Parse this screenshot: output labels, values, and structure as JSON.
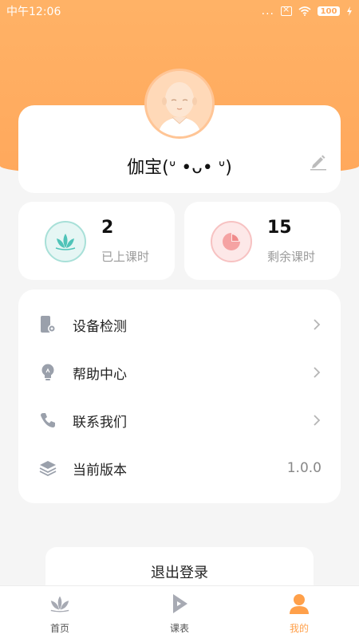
{
  "status_bar": {
    "time": "中午12:06",
    "signal": "...",
    "battery": "100"
  },
  "profile": {
    "nickname": "伽宝(ᐡ •ᴗ• ᐡ)"
  },
  "stats": [
    {
      "value": "2",
      "label": "已上课时",
      "icon": "lotus-icon"
    },
    {
      "value": "15",
      "label": "剩余课时",
      "icon": "pie-chart-icon"
    }
  ],
  "menu": {
    "items": [
      {
        "label": "设备检测",
        "icon": "device-check-icon"
      },
      {
        "label": "帮助中心",
        "icon": "lightbulb-icon"
      },
      {
        "label": "联系我们",
        "icon": "phone-icon"
      },
      {
        "label": "当前版本",
        "icon": "layers-icon",
        "value": "1.0.0"
      }
    ]
  },
  "logout": {
    "label": "退出登录"
  },
  "tabs": [
    {
      "label": "首页",
      "icon": "lotus-icon",
      "active": false
    },
    {
      "label": "课表",
      "icon": "play-icon",
      "active": false
    },
    {
      "label": "我的",
      "icon": "person-icon",
      "active": true
    }
  ],
  "colors": {
    "accent": "#ffa85c",
    "active_tab": "#ffa04a",
    "teal": "#4fc3b8",
    "pink": "#f08a8a"
  }
}
